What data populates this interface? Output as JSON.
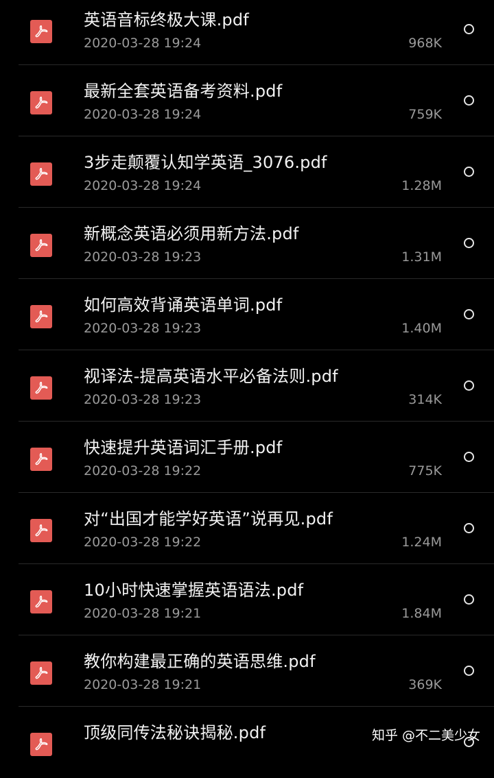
{
  "files": [
    {
      "name": "英语音标终极大课.pdf",
      "date": "2020-03-28 19:24",
      "size": "968K"
    },
    {
      "name": "最新全套英语备考资料.pdf",
      "date": "2020-03-28 19:24",
      "size": "759K"
    },
    {
      "name": "3步走颠覆认知学英语_3076.pdf",
      "date": "2020-03-28 19:24",
      "size": "1.28M"
    },
    {
      "name": "新概念英语必须用新方法.pdf",
      "date": "2020-03-28 19:23",
      "size": "1.31M"
    },
    {
      "name": "如何高效背诵英语单词.pdf",
      "date": "2020-03-28 19:23",
      "size": "1.40M"
    },
    {
      "name": "视译法-提高英语水平必备法则.pdf",
      "date": "2020-03-28 19:23",
      "size": "314K"
    },
    {
      "name": "快速提升英语词汇手册.pdf",
      "date": "2020-03-28 19:22",
      "size": "775K"
    },
    {
      "name": "对“出国才能学好英语”说再见.pdf",
      "date": "2020-03-28 19:22",
      "size": "1.24M"
    },
    {
      "name": "10小时快速掌握英语语法.pdf",
      "date": "2020-03-28 19:21",
      "size": "1.84M"
    },
    {
      "name": "教你构建最正确的英语思维.pdf",
      "date": "2020-03-28 19:21",
      "size": "369K"
    },
    {
      "name": "顶级同传法秘诀揭秘.pdf",
      "date": "",
      "size": ""
    }
  ],
  "watermark": "知乎 @不二美少女",
  "icon": "pdf-file-icon",
  "colors": {
    "background": "#000000",
    "pdf_icon": "#e35b55",
    "primary_text": "#f2f2f2",
    "secondary_text": "#9a9a9a",
    "divider": "#2a2a2a"
  }
}
